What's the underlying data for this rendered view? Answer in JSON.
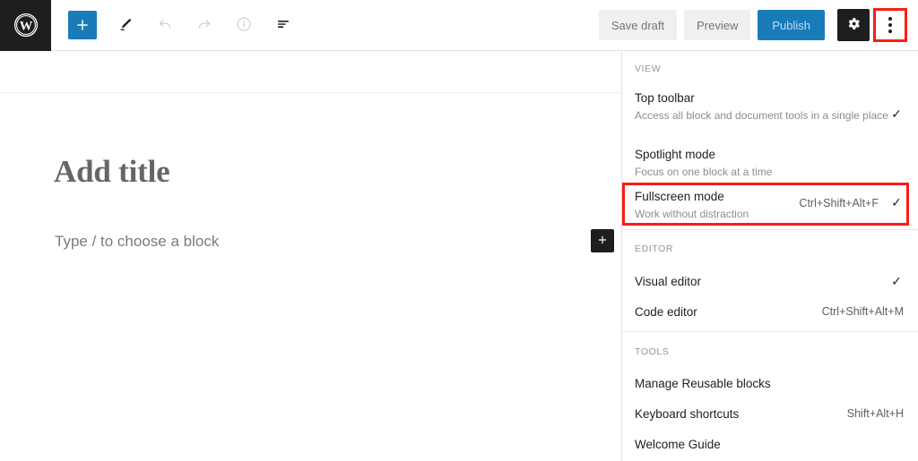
{
  "app": {
    "logo_icon": "wordpress-logo-icon"
  },
  "toolbar": {
    "left": [
      {
        "name": "add-block-button",
        "icon": "plus-icon",
        "label": "Add block"
      },
      {
        "name": "tools-edit-button",
        "icon": "pencil-icon",
        "label": "Tools"
      },
      {
        "name": "undo-button",
        "icon": "undo-arrow-icon",
        "label": "Undo"
      },
      {
        "name": "redo-button",
        "icon": "redo-arrow-icon",
        "label": "Redo"
      },
      {
        "name": "details-button",
        "icon": "info-circle-icon",
        "label": "Details"
      },
      {
        "name": "list-view-button",
        "icon": "list-view-icon",
        "label": "List view"
      }
    ],
    "save_draft_label": "Save draft",
    "preview_label": "Preview",
    "publish_label": "Publish",
    "settings_icon": "gear-icon",
    "more_options_icon": "kebab-vertical-icon"
  },
  "editor": {
    "title_placeholder": "Add title",
    "block_placeholder": "Type / to choose a block",
    "inserter_icon": "plus-icon"
  },
  "menu": {
    "sections": [
      {
        "label": "VIEW",
        "items": [
          {
            "label": "Top toolbar",
            "description": "Access all block and document tools in a single place",
            "shortcut": "",
            "checked": "✓",
            "highlighted": false
          },
          {
            "label": "Spotlight mode",
            "description": "Focus on one block at a time",
            "shortcut": "",
            "checked": "",
            "highlighted": false
          },
          {
            "label": "Fullscreen mode",
            "description": "Work without distraction",
            "shortcut": "Ctrl+Shift+Alt+F",
            "checked": "✓",
            "highlighted": true
          }
        ]
      },
      {
        "label": "EDITOR",
        "items": [
          {
            "label": "Visual editor",
            "description": "",
            "shortcut": "",
            "checked": "✓",
            "highlighted": false
          },
          {
            "label": "Code editor",
            "description": "",
            "shortcut": "Ctrl+Shift+Alt+M",
            "checked": "",
            "highlighted": false
          }
        ]
      },
      {
        "label": "TOOLS",
        "items": [
          {
            "label": "Manage Reusable blocks",
            "description": "",
            "shortcut": "",
            "checked": "",
            "highlighted": false
          },
          {
            "label": "Keyboard shortcuts",
            "description": "",
            "shortcut": "Shift+Alt+H",
            "checked": "",
            "highlighted": false
          },
          {
            "label": "Welcome Guide",
            "description": "",
            "shortcut": "",
            "checked": "",
            "highlighted": false
          }
        ]
      }
    ]
  },
  "colors": {
    "accent_blue": "#1a7bb9",
    "dark": "#1e1e1e",
    "highlight_red": "#fc1c14",
    "muted_text": "#8d8d8d"
  }
}
